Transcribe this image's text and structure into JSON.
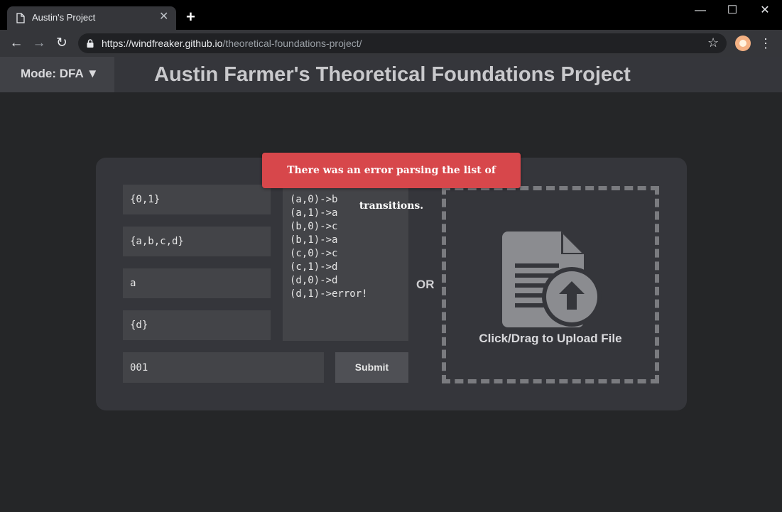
{
  "browser": {
    "tab_title": "Austin's Project",
    "tab_close": "✕",
    "new_tab": "+",
    "url_host": "https://windfreaker.github.io",
    "url_path": "/theoretical-foundations-project/",
    "icons": [
      "doc-icon",
      "back-icon",
      "forward-icon",
      "reload-icon",
      "lock-icon",
      "star-icon",
      "avatar",
      "kebab-icon"
    ],
    "window_controls": {
      "minimize": "—",
      "maximize": "☐",
      "close": "✕"
    }
  },
  "header": {
    "mode_label": "Mode: DFA ▼",
    "title": "Austin Farmer's Theoretical Foundations Project"
  },
  "form": {
    "alphabet": "{0,1}",
    "states": "{a,b,c,d}",
    "start_state": "a",
    "accept_states": "{d}",
    "transitions": [
      "(a,0)->b",
      "(a,1)->a",
      "(b,0)->c",
      "(b,1)->a",
      "(c,0)->c",
      "(c,1)->d",
      "(d,0)->d",
      "(d,1)->error!"
    ],
    "input_string": "001",
    "submit_label": "Submit",
    "or_label": "OR",
    "upload_label": "Click/Drag to Upload File"
  },
  "error_message": "There was an error parsing the list of transitions.",
  "colors": {
    "page_bg": "#252628",
    "panel_bg": "#35363b",
    "field_bg": "#434448",
    "error_bg": "#d7474b",
    "upload_icon": "#8b8c90"
  }
}
